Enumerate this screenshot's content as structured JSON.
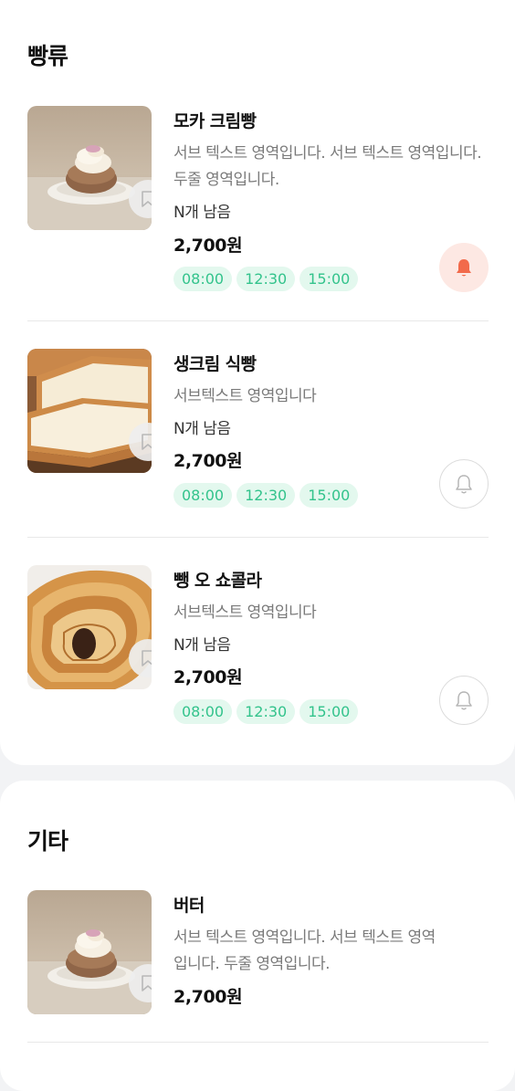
{
  "sections": [
    {
      "title": "빵류",
      "items": [
        {
          "name": "모카 크림빵",
          "desc": "서브 텍스트 영역입니다. 서브 텍스트 영역입니다. 두줄 영역입니다.",
          "stock": "N개 남음",
          "price": "2,700원",
          "times": [
            "08:00",
            "12:30",
            "15:00"
          ],
          "alarm_on": true
        },
        {
          "name": "생크림 식빵",
          "desc": "서브텍스트 영역입니다",
          "stock": "N개 남음",
          "price": "2,700원",
          "times": [
            "08:00",
            "12:30",
            "15:00"
          ],
          "alarm_on": false
        },
        {
          "name": "뺑 오 쇼콜라",
          "desc": "서브텍스트 영역입니다",
          "stock": "N개 남음",
          "price": "2,700원",
          "times": [
            "08:00",
            "12:30",
            "15:00"
          ],
          "alarm_on": false
        }
      ]
    },
    {
      "title": "기타",
      "items": [
        {
          "name": "버터",
          "desc": "서브 텍스트 영역입니다. 서브 텍스트 영역입니다. 두줄 영역입니다.",
          "price": "2,700원"
        }
      ]
    }
  ],
  "icons": {
    "bookmark": "bookmark-icon",
    "bell": "bell-icon"
  },
  "colors": {
    "chip_bg": "#e3f8ee",
    "chip_text": "#33c38c",
    "bell_active": "#f26a4b",
    "bell_active_bg": "#fde8e3",
    "bell_inactive": "#b5b5b5"
  }
}
